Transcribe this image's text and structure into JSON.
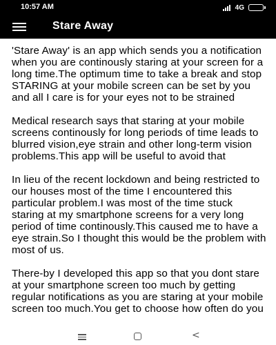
{
  "status_bar": {
    "time": "10:57 AM",
    "network": "4G",
    "icons": [
      "signal-icon",
      "battery-icon"
    ]
  },
  "app_bar": {
    "title": "Stare Away",
    "menu_icon": "hamburger-menu-icon",
    "background_color": "#000000",
    "text_color": "#ffffff"
  },
  "content": {
    "paragraphs": [
      "'Stare Away' is an app which sends you a notification when you are continously staring at your screen for a long time.The optimum time to take a break and stop STARING at your mobile screen can be set by you and all I care is for your eyes not to be strained",
      "Medical research says that staring at your mobile screens continously for long periods of time leads to blurred vision,eye strain and other long-term vision problems.This app will be useful to avoid that",
      "In lieu of the recent lockdown and being restricted to our houses most of the time I encountered this particular problem.I was most of the time stuck staring at my smartphone screens for a very long period of time continously.This caused me to have a eye strain.So I thought this would be the problem with most of us.",
      "There-by I developed this app so that you dont stare at your smartphone screen too much by getting regular notifications as you are staring at your mobile screen too much.You get to choose how often do you"
    ]
  },
  "nav_bar": {
    "icons": [
      "recent-apps-icon",
      "home-icon",
      "back-icon"
    ],
    "back_glyph": "<"
  }
}
